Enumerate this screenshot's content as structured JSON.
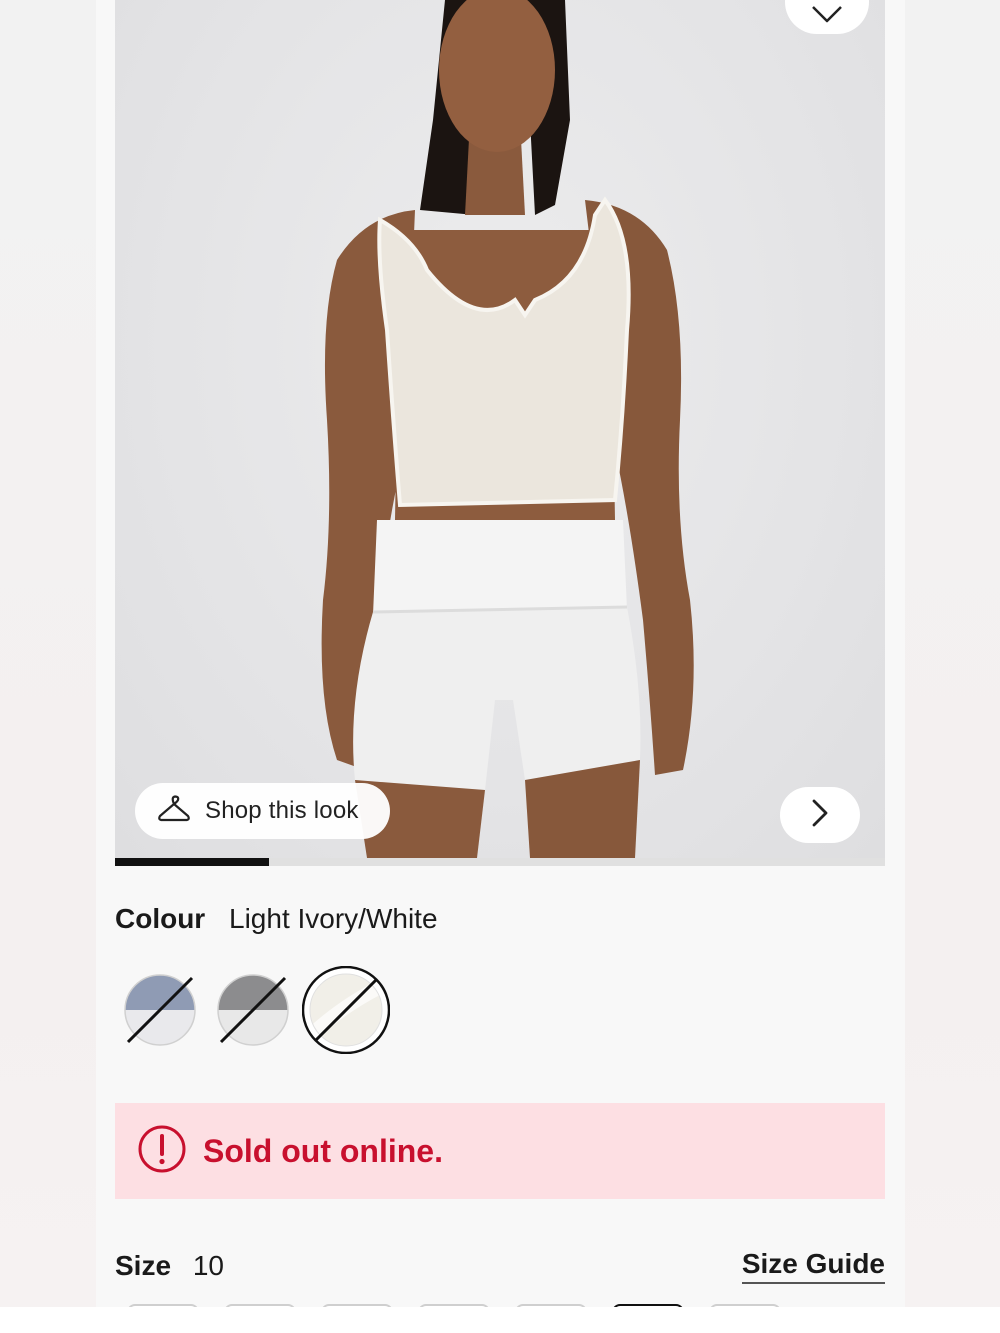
{
  "hero": {
    "shop_look_label": "Shop this look",
    "image_index": 1,
    "image_count": 5
  },
  "colour": {
    "label": "Colour",
    "selected_value": "Light Ivory/White",
    "swatches": [
      {
        "name": "blue-grey/white",
        "top": "#8f9bb4",
        "bottom": "#e9e9ec",
        "sold_out": true,
        "selected": false
      },
      {
        "name": "grey/white",
        "top": "#8c8c8e",
        "bottom": "#e8e8e8",
        "sold_out": true,
        "selected": false
      },
      {
        "name": "light-ivory/white",
        "top": "#f1efe8",
        "bottom": "#ffffff",
        "sold_out": true,
        "selected": true
      }
    ]
  },
  "alert": {
    "message": "Sold out online.",
    "icon": "exclamation-circle-icon",
    "color": "#c8102e"
  },
  "size": {
    "label": "Size",
    "selected_value": "10",
    "guide_label": "Size Guide",
    "chips_visible": 7,
    "selected_chip_index": 5
  }
}
